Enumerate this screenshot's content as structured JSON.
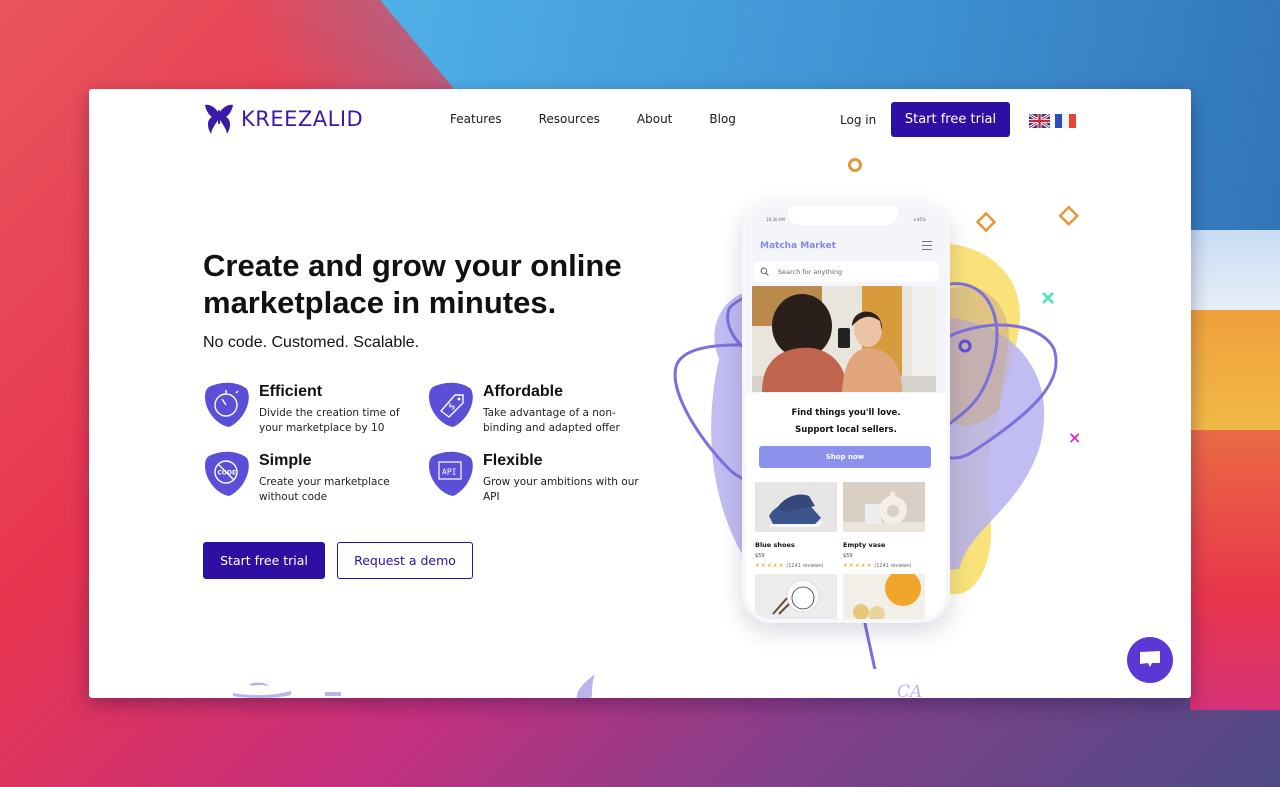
{
  "brand": {
    "name": "KREEZALID",
    "accent_color": "#2e0fa3",
    "logo_icon": "butterfly-icon"
  },
  "nav": {
    "links": [
      {
        "label": "Features"
      },
      {
        "label": "Resources"
      },
      {
        "label": "About"
      },
      {
        "label": "Blog"
      }
    ],
    "login_label": "Log in",
    "cta_label": "Start free trial",
    "languages": [
      {
        "code": "en",
        "icon": "uk-flag-icon"
      },
      {
        "code": "fr",
        "icon": "france-flag-icon"
      }
    ]
  },
  "hero": {
    "title": "Create and grow your online marketplace in minutes.",
    "subtitle": "No code. Customed. Scalable.",
    "features": [
      {
        "title": "Efficient",
        "description": "Divide the creation time of your marketplace by 10",
        "icon": "stopwatch-icon"
      },
      {
        "title": "Affordable",
        "description": "Take advantage of a non-binding and adapted offer",
        "icon": "price-tag-icon"
      },
      {
        "title": "Simple",
        "description": "Create your marketplace without code",
        "icon": "no-code-icon"
      },
      {
        "title": "Flexible",
        "description": "Grow your ambitions with our API",
        "icon": "api-icon"
      }
    ],
    "primary_cta": "Start free trial",
    "secondary_cta": "Request a demo"
  },
  "phone_mockup": {
    "status_time": "10:30 AM",
    "status_right": "▾ 85%",
    "app_title": "Matcha Market",
    "search_placeholder": "Search for anything",
    "tagline_line1": "Find things you'll love.",
    "tagline_line2": "Support local sellers.",
    "shop_button": "Shop now",
    "products": [
      {
        "name": "Blue shoes",
        "price": "$59",
        "stars": "★★★★★",
        "reviews": "(1241 reviews)"
      },
      {
        "name": "Empty vase",
        "price": "$59",
        "stars": "★★★★★",
        "reviews": "(1241 reviews)"
      }
    ]
  },
  "chat": {
    "icon": "chat-bubble-icon",
    "color": "#5b37d6"
  }
}
